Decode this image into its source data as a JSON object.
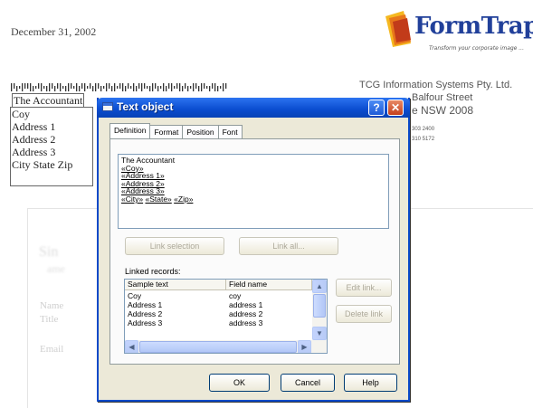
{
  "document": {
    "date": "December 31, 2002",
    "recipient_lines": [
      "The Accountant",
      "Coy",
      "Address 1",
      "Address 2",
      "Address 3",
      "City State Zip"
    ],
    "logo": {
      "name": "FormTrap",
      "tm": "™",
      "tagline": "Transform your corporate image ..."
    },
    "company": {
      "name": "TCG Information Systems Pty. Ltd.",
      "street": "Balfour Street",
      "city": "e  NSW  2008",
      "phone": "303 2400",
      "fax": "310 5172"
    },
    "form_labels": {
      "faint1": "Sin",
      "faint2": "ame",
      "name": "Name",
      "title": "Title",
      "email": "Email"
    }
  },
  "dialog": {
    "title": "Text object",
    "help_button": "?",
    "close_button": "✕",
    "tabs": [
      {
        "label": "Definition"
      },
      {
        "label": "Format"
      },
      {
        "label": "Position"
      },
      {
        "label": "Font"
      }
    ],
    "active_tab": "Definition",
    "preview": {
      "line1": "The Accountant",
      "line2": "«Coy»",
      "line3": "«Address 1»",
      "line4": "«Address 2»",
      "line5": "«Address 3»",
      "line6_city": "«City»",
      "line6_state": "«State»",
      "line6_zip": "«Zip»"
    },
    "buttons": {
      "unlink_selection": "Link selection",
      "link_all": "Link all...",
      "edit": "Edit link...",
      "delete": "Delete link",
      "ok": "OK",
      "cancel": "Cancel",
      "help": "Help"
    },
    "linked_records_label": "Linked records:",
    "grid": {
      "columns": [
        "Sample text",
        "Field name"
      ],
      "rows": [
        [
          "Coy",
          "coy"
        ],
        [
          "Address 1",
          "address 1"
        ],
        [
          "Address 2",
          "address 2"
        ],
        [
          "Address 3",
          "address 3"
        ]
      ]
    }
  }
}
